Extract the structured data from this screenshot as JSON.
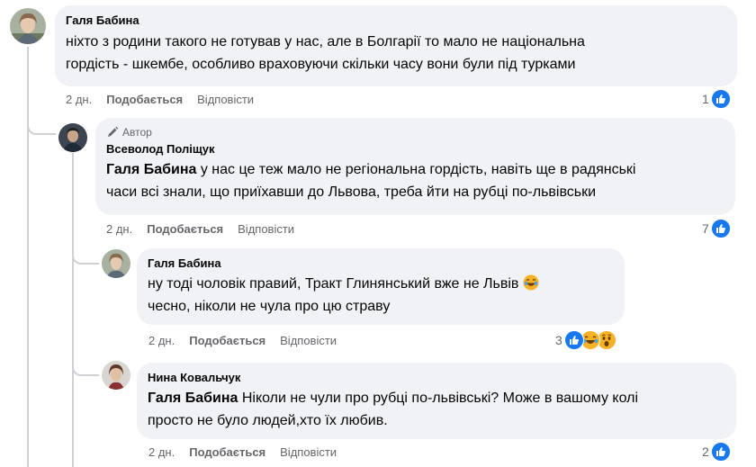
{
  "comments": [
    {
      "author": "Галя Бабина",
      "mention": "",
      "text": "ніхто з родини такого не готував у нас, але в Болгарії то мало не національна",
      "text2": "гордість - шкембе, особливо враховуючи скільки часу вони були під турками",
      "time": "2 дн.",
      "like_label": "Подобається",
      "reply_label": "Відповісти",
      "reaction_count": "1"
    },
    {
      "badge": "Автор",
      "author": "Всеволод Поліщук",
      "mention": "Галя Бабина",
      "text": "у нас це теж мало не регіональна гордість, навіть ще в радянські",
      "text2": "часи всі знали, що приїхавши до Львова, треба йти на рубці по-львівськи",
      "time": "2 дн.",
      "like_label": "Подобається",
      "reply_label": "Відповісти",
      "reaction_count": "7"
    },
    {
      "author": "Галя Бабина",
      "text": "ну тоді чоловік правий, Тракт Глинянський вже не Львів",
      "text2": "чесно, ніколи не чула про цю страву",
      "time": "2 дн.",
      "like_label": "Подобається",
      "reply_label": "Відповісти",
      "reaction_count": "3"
    },
    {
      "author": "Нина Ковальчук",
      "mention": "Галя Бабина",
      "text": "Ніколи не чули про рубці по-львівські? Може в вашому колі",
      "text2": "просто не було людей,хто їх любив.",
      "time": "2 дн.",
      "like_label": "Подобається",
      "reply_label": "Відповісти",
      "reaction_count": "2"
    }
  ],
  "colors": {
    "like_blue": "#1877f2",
    "bubble_bg": "#f0f2f5",
    "meta_gray": "#65676b",
    "thread_line": "#ced0d4"
  },
  "icons": {
    "author_badge": "pencil-icon",
    "like": "thumbs-up-icon",
    "laugh": "laughing-emoji-icon",
    "wow": "wow-emoji-icon"
  }
}
